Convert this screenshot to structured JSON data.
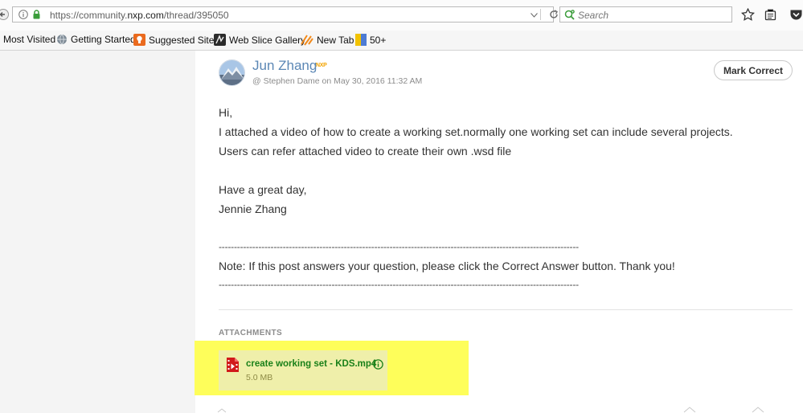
{
  "browser": {
    "url_domain_prefix": "https://community.",
    "url_domain_bold": "nxp.com",
    "url_path": "/thread/395050",
    "search_placeholder": "Search"
  },
  "bookmarks": [
    {
      "label": "Most Visited",
      "icon": "none"
    },
    {
      "label": "Getting Started",
      "icon": "globe-icon"
    },
    {
      "label": "Suggested Sites",
      "icon": "lightbulb-icon"
    },
    {
      "label": "Web Slice Gallery",
      "icon": "slice-icon"
    },
    {
      "label": "New Tab",
      "icon": "newtab-icon"
    },
    {
      "label": "50+",
      "icon": "app-icon"
    }
  ],
  "post": {
    "author": "Jun Zhang",
    "badge": "NXP",
    "meta": "@ Stephen Dame on May 30, 2016 11:32 AM",
    "mark_correct_label": "Mark Correct",
    "lines": [
      "Hi,",
      "I attached a video of how to create a working set.normally one working set can include several projects.",
      "Users can refer attached video to create their own .wsd file",
      "Have a great day,",
      "Jennie Zhang",
      "----------------------------------------------------------------------------------------------------------------------",
      "Note: If this post answers your question, please click the Correct Answer button. Thank you!",
      "----------------------------------------------------------------------------------------------------------------------"
    ]
  },
  "attachments": {
    "label": "ATTACHMENTS",
    "items": [
      {
        "name": "create working set - KDS.mp4",
        "size": "5.0 MB"
      }
    ]
  },
  "colors": {
    "author_link": "#5b87b5",
    "highlight": "#fefe5a",
    "attachment_name": "#1a8019"
  }
}
